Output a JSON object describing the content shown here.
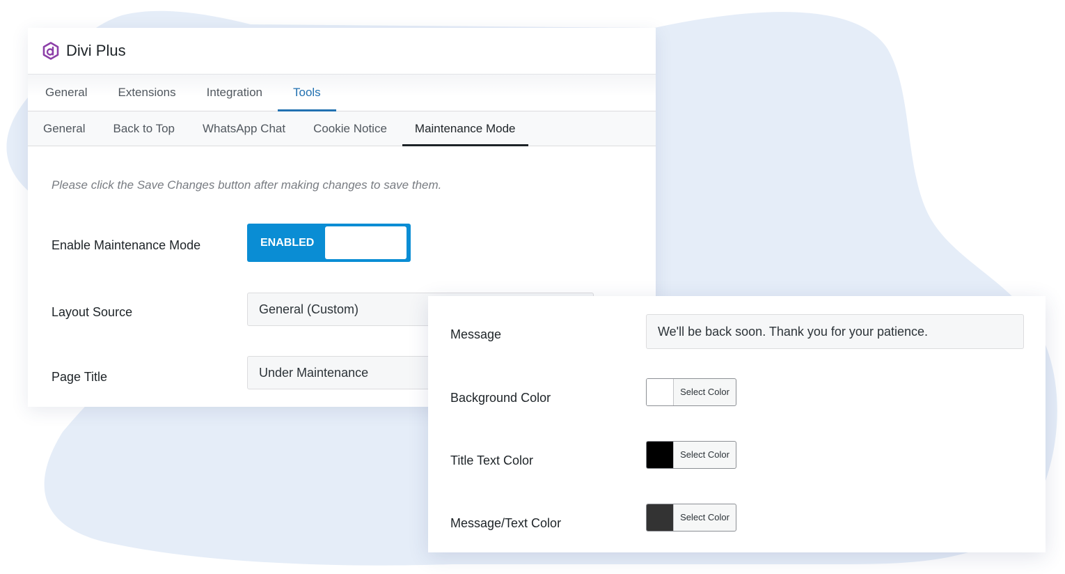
{
  "app": {
    "name": "Divi Plus"
  },
  "primary_tabs": [
    {
      "label": "General",
      "active": false
    },
    {
      "label": "Extensions",
      "active": false
    },
    {
      "label": "Integration",
      "active": false
    },
    {
      "label": "Tools",
      "active": true
    }
  ],
  "secondary_tabs": [
    {
      "label": "General",
      "active": false
    },
    {
      "label": "Back to Top",
      "active": false
    },
    {
      "label": "WhatsApp Chat",
      "active": false
    },
    {
      "label": "Cookie Notice",
      "active": false
    },
    {
      "label": "Maintenance Mode",
      "active": true
    }
  ],
  "notice": "Please click the Save Changes button after making changes to save them.",
  "settings": {
    "enable_label": "Enable Maintenance Mode",
    "toggle_state": "ENABLED",
    "layout_source_label": "Layout Source",
    "layout_source_value": "General (Custom)",
    "page_title_label": "Page Title",
    "page_title_value": "Under Maintenance"
  },
  "overlay": {
    "message_label": "Message",
    "message_value": "We'll be back soon. Thank you for your patience.",
    "select_color_label": "Select Color",
    "colors": [
      {
        "label": "Background Color",
        "swatch": "#ffffff"
      },
      {
        "label": "Title Text Color",
        "swatch": "#000000"
      },
      {
        "label": "Message/Text Color",
        "swatch": "#333333"
      }
    ]
  },
  "theme": {
    "accent": "#2271b1",
    "toggle_blue": "#0a8dd4",
    "logo_purple": "#8c3fa8",
    "blob": "#e5edf8"
  }
}
